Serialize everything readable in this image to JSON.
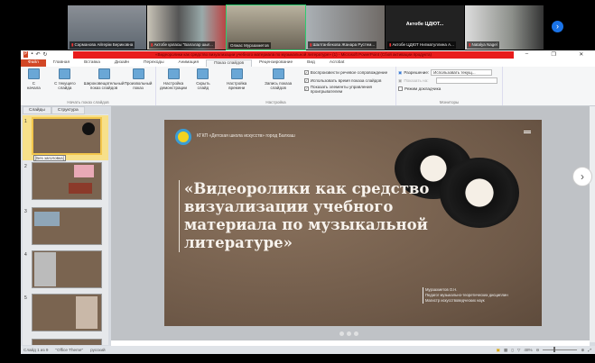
{
  "conference": {
    "participants": [
      {
        "name": "Сәрманова Айгерім Бериковна",
        "muted": true
      },
      {
        "name": "Актобе қаласы \"Балалар шығ...",
        "muted": true
      },
      {
        "name": "Олжас Мурзахметов",
        "muted": false,
        "speaking": true
      },
      {
        "name": "Шалтанбекова Жанара Рустем...",
        "muted": true
      },
      {
        "name": "Актобе ЦДЮТ Нигматуллина А...",
        "muted": true,
        "label": "Актобе ЦДЮТ..."
      },
      {
        "name": "Natalya Nagel",
        "muted": true
      }
    ],
    "next_icon": "chevron-right-icon"
  },
  "powerpoint": {
    "title": "«Видеоролики как средство визуализации учебного материала по музыкальной литературе» (1) - Microsoft PowerPoint (Сбой активации продукта)",
    "tabs": [
      "Файл",
      "Главная",
      "Вставка",
      "Дизайн",
      "Переходы",
      "Анимация",
      "Показ слайдов",
      "Рецензирование",
      "Вид",
      "Acrobat"
    ],
    "active_tab": "Показ слайдов",
    "groups": {
      "start": {
        "label": "Начать показ слайдов",
        "buttons": [
          "С начала",
          "С текущего слайда",
          "Широковещательный показ слайдов",
          "Произвольный показ"
        ]
      },
      "setup": {
        "label": "Настройка",
        "buttons": [
          "Настройка демонстрации",
          "Скрыть слайд",
          "Настройка времени",
          "Запись показа слайдов"
        ],
        "checks": [
          {
            "label": "Воспроизвести речевое сопровождение",
            "checked": true
          },
          {
            "label": "Использовать время показа слайдов",
            "checked": true
          },
          {
            "label": "Показать элементы управления проигрывателем",
            "checked": true
          }
        ]
      },
      "monitors": {
        "label": "Мониторы",
        "resolution_label": "Разрешение:",
        "resolution_value": "Использовать текущ...",
        "show_on_label": "Показать на:",
        "presenter_label": "Режим докладчика",
        "presenter_checked": false
      }
    },
    "pane_tabs": [
      "Слайды",
      "Структура"
    ],
    "tooltip": "[Без заголовка]",
    "slides": [
      1,
      2,
      3,
      4,
      5
    ],
    "slide": {
      "org": "КГКП «Детская школа искусств» город Балхаш",
      "title_lines": [
        "«Видеоролики как средство",
        "визуализации учебного",
        "материала по музыкальной",
        "литературе»"
      ],
      "author": [
        "Мурзахметов О.Н.",
        "Педагог музыкально-теоретических дисциплин",
        "Магистр искусствоведческих наук"
      ]
    },
    "status": {
      "slide": "Слайд 1 из 9",
      "theme": "\"Office Theme\"",
      "lang": "русский",
      "zoom": "48%"
    }
  }
}
